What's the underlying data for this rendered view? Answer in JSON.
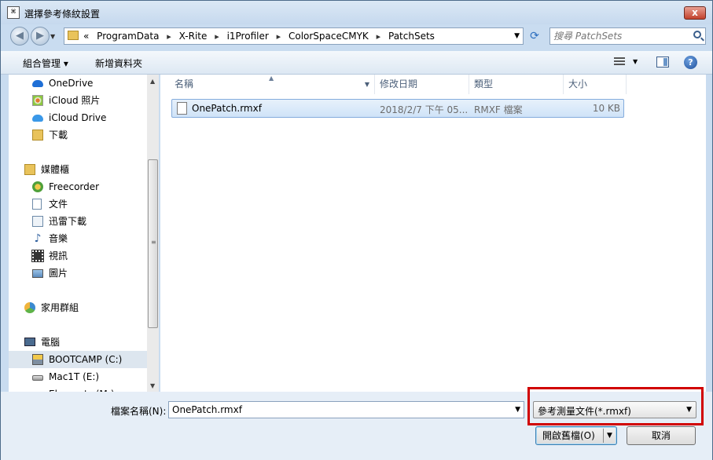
{
  "window": {
    "title": "選擇參考條紋設置",
    "icon_label": "⌘",
    "close_label": "x"
  },
  "address": {
    "overflow": "«",
    "crumbs": [
      "ProgramData",
      "X-Rite",
      "i1Profiler",
      "ColorSpaceCMYK",
      "PatchSets"
    ],
    "separator": "▸",
    "search_placeholder": "搜尋 PatchSets"
  },
  "toolbar": {
    "organize_label": "組合管理 ▾",
    "new_folder_label": "新增資料夾"
  },
  "nav": {
    "items": [
      {
        "label": "OneDrive",
        "icon": "cloud-icon",
        "color": "#1f6fd6"
      },
      {
        "label": "iCloud 照片",
        "icon": "photos-icon",
        "color": "#e07a2f"
      },
      {
        "label": "iCloud Drive",
        "icon": "cloud-icon",
        "color": "#3a98e8"
      },
      {
        "label": "下載",
        "icon": "download-folder-icon",
        "color": "#e9c35b"
      },
      {
        "label": "媒體櫃",
        "icon": "library-icon",
        "color": "#e9c35b"
      },
      {
        "label": "Freecorder",
        "icon": "freecorder-icon",
        "color": "#4fa03a"
      },
      {
        "label": "文件",
        "icon": "document-icon",
        "color": "#8aa2bd"
      },
      {
        "label": "迅雷下載",
        "icon": "thunder-download-icon",
        "color": "#8aa2bd"
      },
      {
        "label": "音樂",
        "icon": "music-icon",
        "color": "#2b5d9c"
      },
      {
        "label": "視訊",
        "icon": "video-icon",
        "color": "#333333"
      },
      {
        "label": "圖片",
        "icon": "picture-icon",
        "color": "#5b8bbd"
      },
      {
        "label": "家用群組",
        "icon": "homegroup-icon",
        "color": "#3b8ad0"
      },
      {
        "label": "電腦",
        "icon": "computer-icon",
        "color": "#4a6b8f"
      },
      {
        "label": "BOOTCAMP (C:)",
        "icon": "windows-drive-icon",
        "color": "#7f8fa0"
      },
      {
        "label": "Mac1T (E:)",
        "icon": "drive-icon",
        "color": "#9a9a9a"
      },
      {
        "label": "Elements (M:)",
        "icon": "drive-icon",
        "color": "#9a9a9a"
      }
    ]
  },
  "columns": [
    "名稱",
    "修改日期",
    "類型",
    "大小"
  ],
  "files": [
    {
      "name": "OnePatch.rmxf",
      "modified": "2018/2/7 下午 05...",
      "type": "RMXF 檔案",
      "size": "10 KB"
    }
  ],
  "bottom": {
    "filename_label": "檔案名稱(N):",
    "filename_value": "OnePatch.rmxf",
    "filetype_value": "參考測量文件(*.rmxf)",
    "open_label": "開啟舊檔(O)",
    "cancel_label": "取消"
  }
}
